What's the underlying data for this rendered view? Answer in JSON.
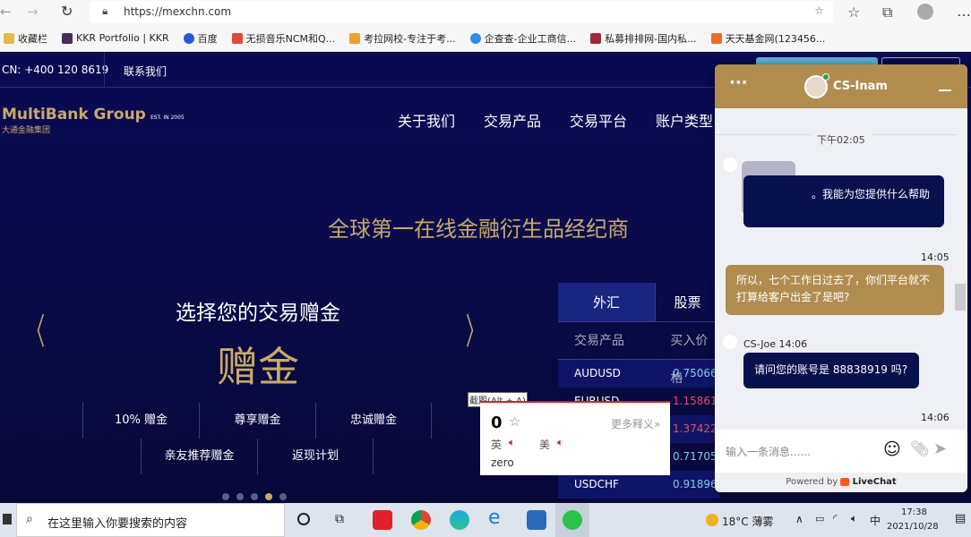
{
  "browser": {
    "url": "https://mexchn.com",
    "bookmarks": [
      "收藏栏",
      "KKR Portfolio | KKR",
      "百度",
      "无损音乐NCM和Q...",
      "考拉网校-专注于考...",
      "企查查-企业工商信...",
      "私募排排网-国内私...",
      "天天基金网(123456..."
    ]
  },
  "site": {
    "phone": "CN: +400 120 8619",
    "contact": "联系我们",
    "logo": "MultiBank Group",
    "logo_cn": "大通金融集团",
    "logo_est": "EST. IN 2005",
    "nav": [
      "关于我们",
      "交易产品",
      "交易平台",
      "账户类型"
    ],
    "tagline": "全球第一在线金融衍生品经纪商",
    "slide": {
      "title": "选择您的交易赠金",
      "big": "赠金",
      "options": [
        "10% 赠金",
        "尊享赠金",
        "忠诚赠金",
        "亲友推荐赠金",
        "返现计划"
      ],
      "active_dot": 4,
      "dot_count": 5
    },
    "table": {
      "tabs": [
        "外汇",
        "股票"
      ],
      "headers": [
        "交易产品",
        "买入价格"
      ],
      "rows": [
        {
          "symbol": "AUDUSD",
          "price": "0.75066",
          "color": "#7fd0e8"
        },
        {
          "symbol": "EURUSD",
          "price": "1.15861",
          "color": "#e0506a"
        },
        {
          "symbol": "",
          "price": "1.37422",
          "color": "#e0506a"
        },
        {
          "symbol": "",
          "price": "0.71705",
          "color": "#7fd0e8"
        },
        {
          "symbol": "USDCHF",
          "price": "0.91896",
          "color": "#7fd0e8"
        }
      ]
    }
  },
  "dict": {
    "screenshot_hint": "截图(Alt + A)",
    "word": "0",
    "more": "更多释义»",
    "uk": "英",
    "us": "美",
    "meaning": "zero"
  },
  "chat": {
    "agent": "CS-Inam",
    "date_sep": "下午02:05",
    "messages": [
      {
        "text": "。我能为您提供什么帮助"
      },
      {
        "time": "14:05",
        "text": "所以，七个工作日过去了，你们平台就不打算给客户出金了是吧?"
      },
      {
        "meta": "CS-Joe 14:06",
        "text": "请问您的账号是 88838919 吗?"
      },
      {
        "time": "14:06"
      }
    ],
    "placeholder": "输入一条消息......",
    "powered": "Powered by",
    "brand": "LiveChat"
  },
  "taskbar": {
    "search": "在这里输入你要搜索的内容",
    "weather": "18°C 薄雾",
    "ime": "中",
    "time": "17:38",
    "date": "2021/10/28"
  }
}
